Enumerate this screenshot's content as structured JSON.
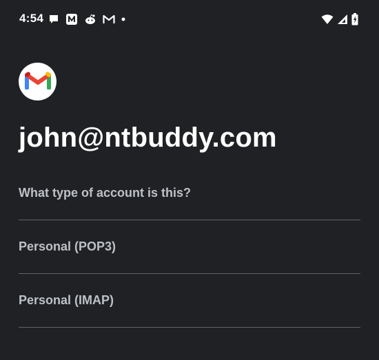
{
  "status_bar": {
    "time": "4:54",
    "left_icons": [
      "chat-bubble-icon",
      "app-n-icon",
      "reddit-icon",
      "gmail-outline-icon",
      "dot-icon"
    ],
    "right_icons": [
      "wifi-icon",
      "cellular-signal-icon",
      "battery-charging-icon"
    ]
  },
  "header": {
    "logo": "gmail-logo-icon",
    "email": "john@ntbuddy.com"
  },
  "account_type": {
    "question": "What type of account is this?",
    "options": [
      {
        "label": "Personal (POP3)"
      },
      {
        "label": "Personal (IMAP)"
      }
    ]
  },
  "colors": {
    "background": "#202124",
    "primary_text": "#ffffff",
    "secondary_text": "#bdc1c6",
    "divider": "#5f6368",
    "gmail_red": "#EA4335",
    "gmail_blue": "#4285F4",
    "gmail_green": "#34A853",
    "gmail_yellow": "#FBBC04"
  }
}
